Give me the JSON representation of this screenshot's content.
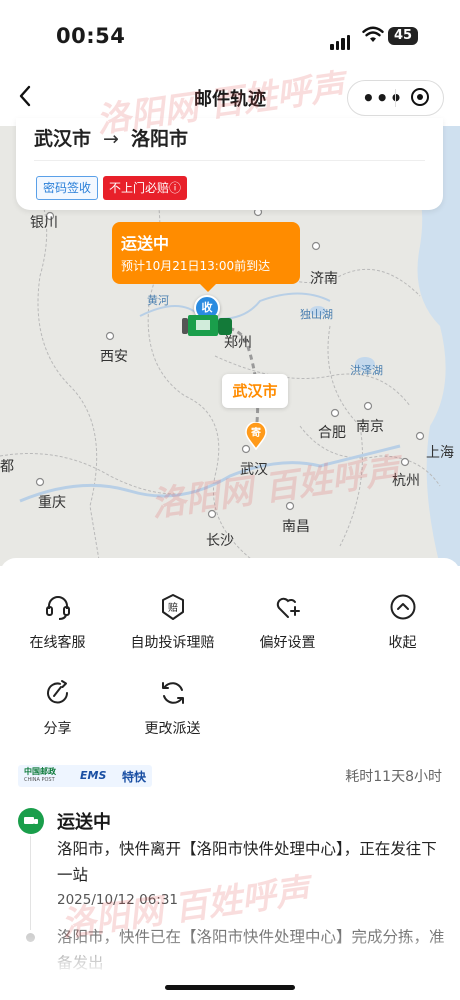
{
  "status_bar": {
    "time": "00:54",
    "battery": "45"
  },
  "nav": {
    "title": "邮件轨迹"
  },
  "route": {
    "from": "武汉市",
    "arrow": "→",
    "to": "洛阳市"
  },
  "tags": {
    "pin_sign": "密码签收",
    "no_door": "不上门必赔",
    "info_glyph": "ⓘ"
  },
  "bubble": {
    "status": "运送中",
    "eta": "预计10月21日13:00前到达"
  },
  "map": {
    "origin_marker": "寄",
    "dest_marker": "收",
    "origin_label": "武汉市",
    "cities": [
      "银川",
      "济南",
      "黄河",
      "郑州",
      "独山湖",
      "西安",
      "洪泽湖",
      "合肥",
      "南京",
      "上海",
      "武汉",
      "杭州",
      "重庆",
      "南昌",
      "长沙",
      "都"
    ]
  },
  "actions": [
    {
      "label": "在线客服",
      "icon": "headset-icon"
    },
    {
      "label": "自助投诉理赔",
      "icon": "compensation-icon"
    },
    {
      "label": "偏好设置",
      "icon": "heart-plus-icon"
    },
    {
      "label": "收起",
      "icon": "chevron-up-icon"
    },
    {
      "label": "分享",
      "icon": "share-icon"
    },
    {
      "label": "更改派送",
      "icon": "refresh-icon"
    }
  ],
  "brand": {
    "china_post": "中国邮政",
    "china_post_en": "CHINA POST",
    "ems": "EMS",
    "service": "特快"
  },
  "duration": "耗时11天8小时",
  "timeline": [
    {
      "status": "运送中",
      "desc": "洛阳市，快件离开【洛阳市快件处理中心】，正在发往下一站",
      "time": "2025/10/12 06:31"
    },
    {
      "desc": "洛阳市，快件已在【洛阳市快件处理中心】完成分拣，准备发出"
    }
  ],
  "watermark": "洛阳网 百姓呼声",
  "colors": {
    "accent": "#ff8c00",
    "red": "#e8202a",
    "green": "#1a9e4b",
    "blue": "#2a7fd8"
  }
}
